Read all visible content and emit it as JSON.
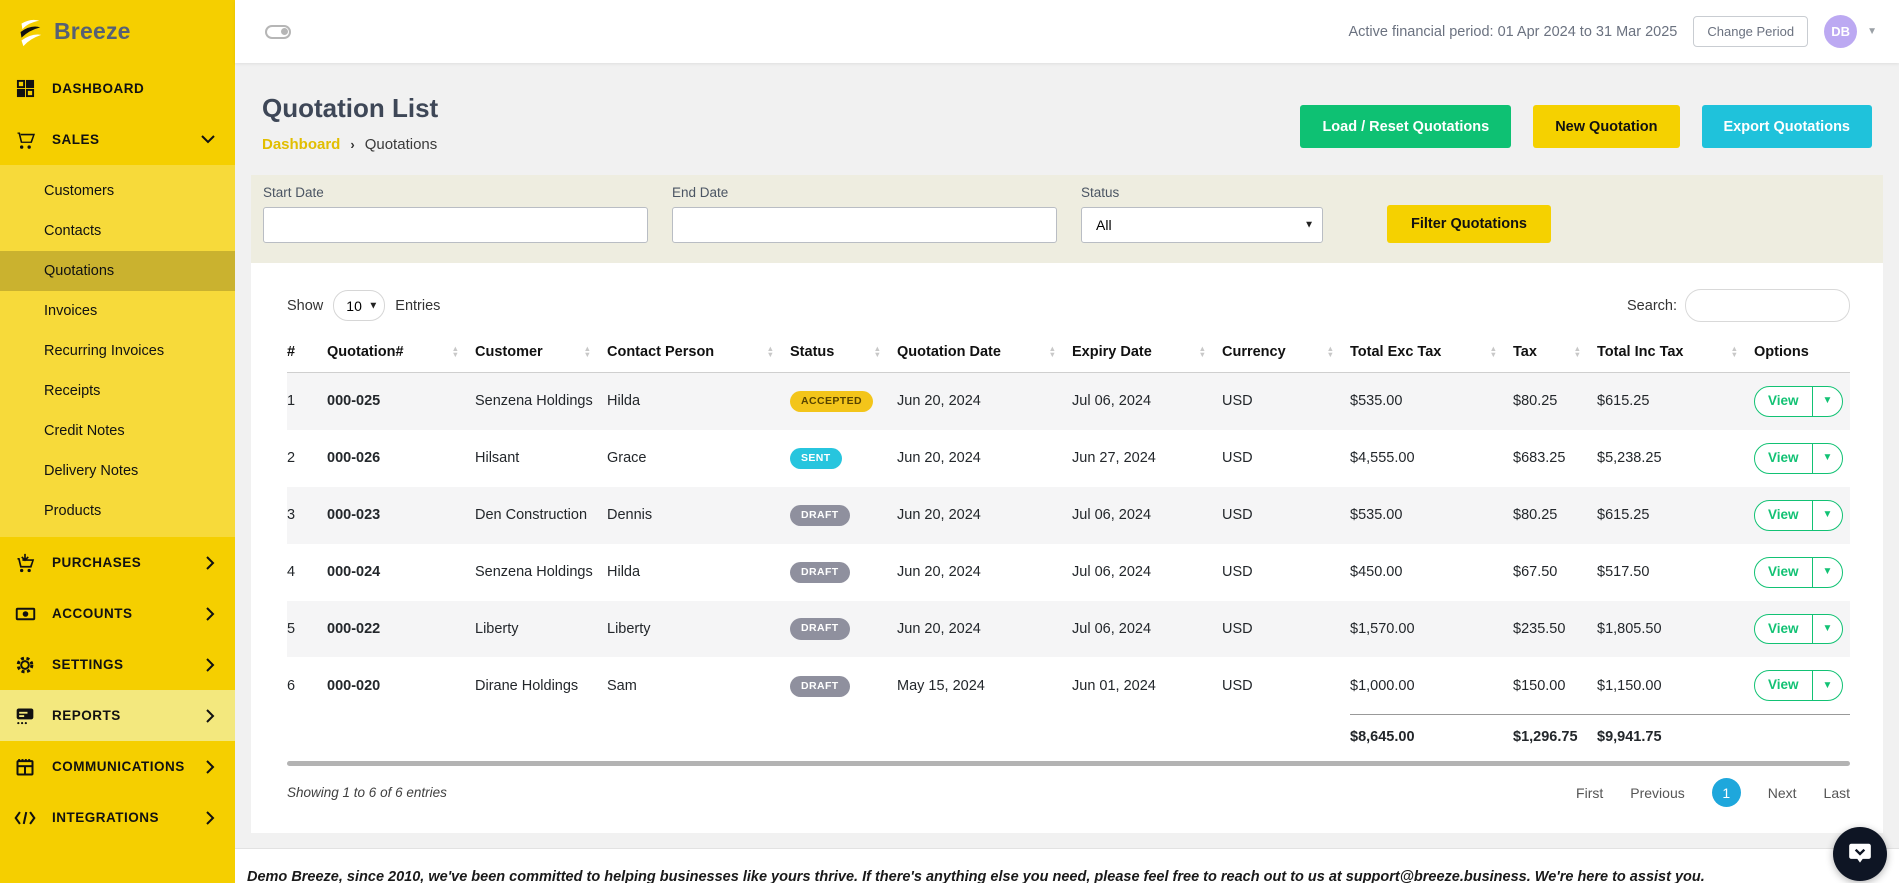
{
  "brand": {
    "logo_text": "Breeze"
  },
  "topbar": {
    "financial_period": "Active financial period: 01 Apr 2024 to 31 Mar 2025",
    "change_period_label": "Change Period",
    "avatar_initials": "DB"
  },
  "sidebar": {
    "items": [
      "DASHBOARD",
      "SALES",
      "PURCHASES",
      "ACCOUNTS",
      "SETTINGS",
      "REPORTS",
      "COMMUNICATIONS",
      "INTEGRATIONS"
    ],
    "sales_submenu": [
      "Customers",
      "Contacts",
      "Quotations",
      "Invoices",
      "Recurring Invoices",
      "Receipts",
      "Credit Notes",
      "Delivery Notes",
      "Products"
    ],
    "active_submenu_item": "Quotations"
  },
  "page": {
    "title": "Quotation List",
    "breadcrumb": [
      "Dashboard",
      "Quotations"
    ]
  },
  "actions": {
    "load_reset": "Load / Reset Quotations",
    "new_quotation": "New Quotation",
    "export": "Export Quotations"
  },
  "filters": {
    "start_date_label": "Start Date",
    "end_date_label": "End Date",
    "status_label": "Status",
    "status_value": "All",
    "filter_button": "Filter Quotations"
  },
  "controls": {
    "show_label": "Show",
    "page_size": "10",
    "entries_label": "Entries",
    "search_label": "Search:"
  },
  "table": {
    "headers": [
      "#",
      "Quotation#",
      "Customer",
      "Contact Person",
      "Status",
      "Quotation Date",
      "Expiry Date",
      "Currency",
      "Total Exc Tax",
      "Tax",
      "Total Inc Tax",
      "Options"
    ],
    "rows": [
      {
        "num": "1",
        "quotation": "000-025",
        "customer": "Senzena Holdings",
        "contact": "Hilda",
        "status": "ACCEPTED",
        "status_type": "accepted",
        "qdate": "Jun 20, 2024",
        "edate": "Jul 06, 2024",
        "currency": "USD",
        "exc": "$535.00",
        "tax": "$80.25",
        "inc": "$615.25"
      },
      {
        "num": "2",
        "quotation": "000-026",
        "customer": "Hilsant",
        "contact": "Grace",
        "status": "SENT",
        "status_type": "sent",
        "qdate": "Jun 20, 2024",
        "edate": "Jun 27, 2024",
        "currency": "USD",
        "exc": "$4,555.00",
        "tax": "$683.25",
        "inc": "$5,238.25"
      },
      {
        "num": "3",
        "quotation": "000-023",
        "customer": "Den Construction",
        "contact": "Dennis",
        "status": "DRAFT",
        "status_type": "draft",
        "qdate": "Jun 20, 2024",
        "edate": "Jul 06, 2024",
        "currency": "USD",
        "exc": "$535.00",
        "tax": "$80.25",
        "inc": "$615.25"
      },
      {
        "num": "4",
        "quotation": "000-024",
        "customer": "Senzena Holdings",
        "contact": "Hilda",
        "status": "DRAFT",
        "status_type": "draft",
        "qdate": "Jun 20, 2024",
        "edate": "Jul 06, 2024",
        "currency": "USD",
        "exc": "$450.00",
        "tax": "$67.50",
        "inc": "$517.50"
      },
      {
        "num": "5",
        "quotation": "000-022",
        "customer": "Liberty",
        "contact": "Liberty",
        "status": "DRAFT",
        "status_type": "draft",
        "qdate": "Jun 20, 2024",
        "edate": "Jul 06, 2024",
        "currency": "USD",
        "exc": "$1,570.00",
        "tax": "$235.50",
        "inc": "$1,805.50"
      },
      {
        "num": "6",
        "quotation": "000-020",
        "customer": "Dirane Holdings",
        "contact": "Sam",
        "status": "DRAFT",
        "status_type": "draft",
        "qdate": "May 15, 2024",
        "edate": "Jun 01, 2024",
        "currency": "USD",
        "exc": "$1,000.00",
        "tax": "$150.00",
        "inc": "$1,150.00"
      }
    ],
    "totals": {
      "exc": "$8,645.00",
      "tax": "$1,296.75",
      "inc": "$9,941.75"
    },
    "view_label": "View",
    "showing": "Showing 1 to 6 of 6 entries",
    "pagination": {
      "first": "First",
      "previous": "Previous",
      "page": "1",
      "next": "Next",
      "last": "Last"
    }
  },
  "footer": {
    "message": "Demo Breeze, since 2010, we've been committed to helping businesses like yours thrive. If there's anything else you need, please feel free to reach out to us at support@breeze.business. We're here to assist you."
  },
  "colors": {
    "sidebar_yellow": "#F5CF00",
    "submenu_yellow": "#F7DA3A",
    "filter_beige": "#EEEDE0",
    "green": "#0EC173",
    "cyan": "#1FC2DB",
    "pagination_blue": "#1EA7DC",
    "avatar_purple": "#BCA9F2",
    "badge_accepted": "#F3C51A",
    "badge_sent": "#27C5DE",
    "badge_draft": "#8F909E"
  }
}
